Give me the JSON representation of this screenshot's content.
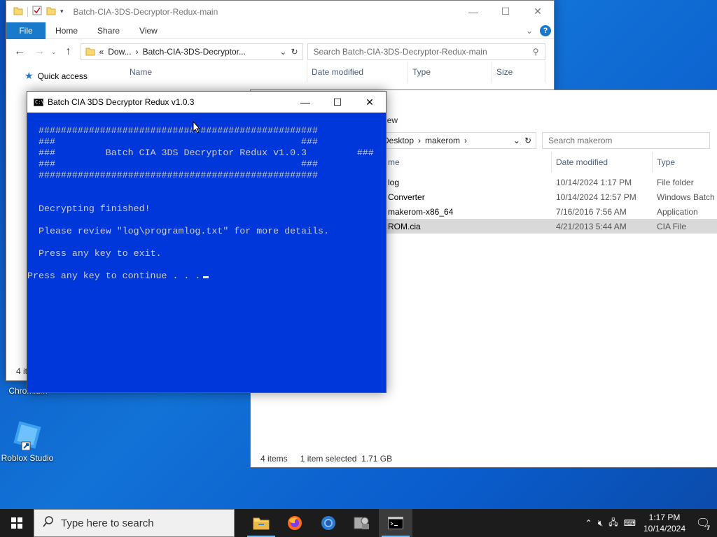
{
  "desktop": {
    "icons": [
      {
        "label": "Chromium"
      },
      {
        "label": "Roblox Studio"
      }
    ]
  },
  "explorer_back": {
    "title": "Batch-CIA-3DS-Decryptor-Redux-main",
    "ribbon": {
      "file": "File",
      "home": "Home",
      "share": "Share",
      "view": "View"
    },
    "address": {
      "prefix": "«",
      "seg1": "Dow...",
      "sep": "›",
      "seg2": "Batch-CIA-3DS-Decryptor..."
    },
    "search_placeholder": "Search Batch-CIA-3DS-Decryptor-Redux-main",
    "nav": {
      "quick_access": "Quick access"
    },
    "columns": {
      "name": "Name",
      "date": "Date modified",
      "type": "Type",
      "size": "Size"
    },
    "status_partial": "4 it"
  },
  "explorer_front": {
    "ribbon_partial": "iew",
    "address": {
      "seg1": "Desktop",
      "sep": "›",
      "seg2": "makerom"
    },
    "search_placeholder": "Search makerom",
    "columns": {
      "name": "me",
      "date": "Date modified",
      "type": "Type"
    },
    "files": [
      {
        "name": "log",
        "date": "10/14/2024 1:17 PM",
        "type": "File folder"
      },
      {
        "name": "Converter",
        "date": "10/14/2024 12:57 PM",
        "type": "Windows Batch"
      },
      {
        "name": "makerom-x86_64",
        "date": "7/16/2016 7:56 AM",
        "type": "Application"
      },
      {
        "name": "ROM.cia",
        "date": "4/21/2013 5:44 AM",
        "type": "CIA File"
      }
    ],
    "status": {
      "count": "4 items",
      "selected": "1 item selected",
      "size": "1.71 GB"
    }
  },
  "console": {
    "title": "Batch CIA 3DS Decryptor Redux v1.0.3",
    "lines": {
      "l1": "##################################################",
      "l2": "###                                            ###",
      "l3": "###         Batch CIA 3DS Decryptor Redux v1.0.3         ###",
      "l4": "###                                            ###",
      "l5": "##################################################",
      "l6": "Decrypting finished!",
      "l7": "Please review \"log\\programlog.txt\" for more details.",
      "l8": "Press any key to exit.",
      "l9": "Press any key to continue . . ."
    }
  },
  "taskbar": {
    "search_placeholder": "Type here to search",
    "apps": [
      "file-explorer",
      "firefox",
      "chromium",
      "app-manager",
      "command-prompt"
    ],
    "time": "1:17 PM",
    "date": "10/14/2024",
    "notification_count": "7"
  },
  "colors": {
    "console_bg": "#0037da",
    "console_fg": "#cccccc",
    "accent": "#1979ca",
    "taskbar": "#1c1c1c"
  }
}
